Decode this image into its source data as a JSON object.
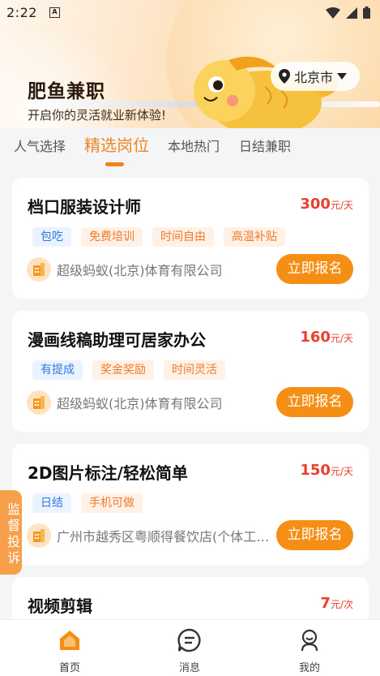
{
  "status": {
    "time": "2:22",
    "notif_glyph": "A"
  },
  "header": {
    "app_title": "肥鱼兼职",
    "subtitle": "开启你的灵活就业新体验!",
    "city": "北京市"
  },
  "tabs": [
    {
      "label": "人气选择",
      "active": false
    },
    {
      "label": "精选岗位",
      "active": true
    },
    {
      "label": "本地热门",
      "active": false
    },
    {
      "label": "日结兼职",
      "active": false
    }
  ],
  "jobs": [
    {
      "title": "档口服装设计师",
      "salary": "300",
      "unit": "元/天",
      "tags": [
        {
          "text": "包吃",
          "color": "blue"
        },
        {
          "text": "免费培训",
          "color": "orange"
        },
        {
          "text": "时间自由",
          "color": "orange"
        },
        {
          "text": "高温补贴",
          "color": "orange"
        }
      ],
      "company": "超级蚂蚁(北京)体育有限公司",
      "apply_label": "立即报名"
    },
    {
      "title": "漫画线稿助理可居家办公",
      "salary": "160",
      "unit": "元/天",
      "tags": [
        {
          "text": "有提成",
          "color": "blue"
        },
        {
          "text": "奖金奖励",
          "color": "orange"
        },
        {
          "text": "时间灵活",
          "color": "orange"
        }
      ],
      "company": "超级蚂蚁(北京)体育有限公司",
      "apply_label": "立即报名"
    },
    {
      "title": "2D图片标注/轻松简单",
      "salary": "150",
      "unit": "元/天",
      "tags": [
        {
          "text": "日结",
          "color": "blue"
        },
        {
          "text": "手机可做",
          "color": "orange"
        }
      ],
      "company": "广州市越秀区粤顺得餐饮店(个体工商户)",
      "apply_label": "立即报名"
    },
    {
      "title": "视频剪辑",
      "salary": "7",
      "unit": "元/次"
    }
  ],
  "side_button": "监督投诉",
  "bottom_nav": [
    {
      "label": "首页",
      "icon": "home-icon",
      "active": true
    },
    {
      "label": "消息",
      "icon": "message-icon",
      "active": false
    },
    {
      "label": "我的",
      "icon": "profile-icon",
      "active": false
    }
  ],
  "colors": {
    "accent": "#f2841c",
    "salary": "#e8402c",
    "apply": "#f58e14",
    "tag_blue": "#2f7ad9",
    "tag_orange": "#ef7a2a"
  }
}
